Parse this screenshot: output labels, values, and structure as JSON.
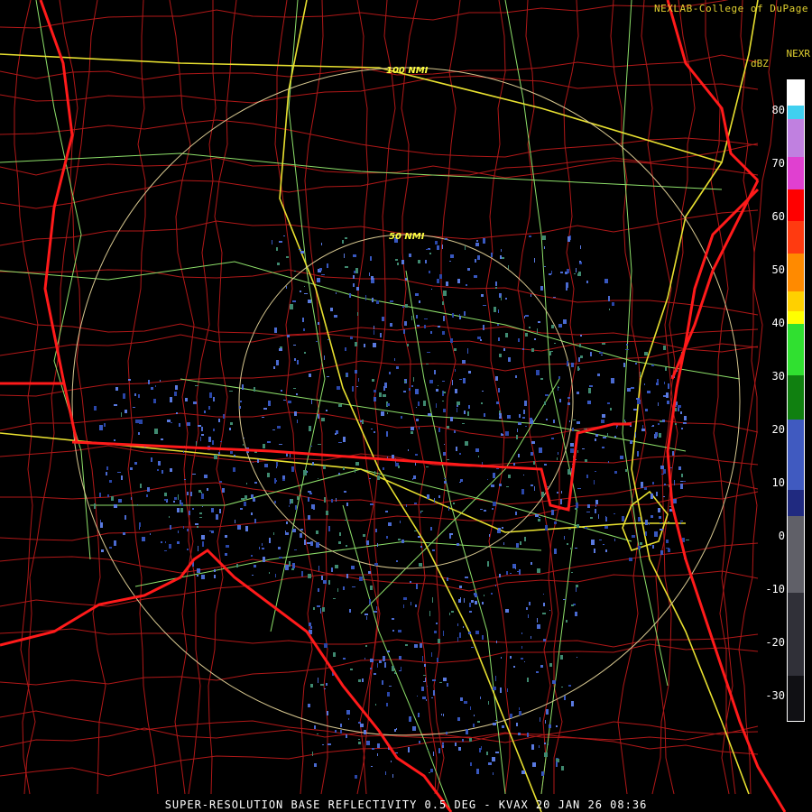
{
  "credit": "NEXLAB-College of DuPage",
  "product_label": "NEXR",
  "scale": {
    "unit": "dBZ",
    "ticks": [
      "80",
      "70",
      "60",
      "50",
      "40",
      "30",
      "20",
      "10",
      "0",
      "-10",
      "-20",
      "-30"
    ]
  },
  "rings": [
    {
      "label": "100 NMI"
    },
    {
      "label": "50 NMI"
    }
  ],
  "footer": "SUPER-RESOLUTION BASE REFLECTIVITY 0.5 DEG - KVAX 20 JAN 26 08:36",
  "colors": {
    "state_border": "#ff1a1a",
    "county_border": "#c01818",
    "highway": "#e8e030",
    "road": "#90e070",
    "range_ring": "#d8c890",
    "echo": "#4a6ad0"
  }
}
